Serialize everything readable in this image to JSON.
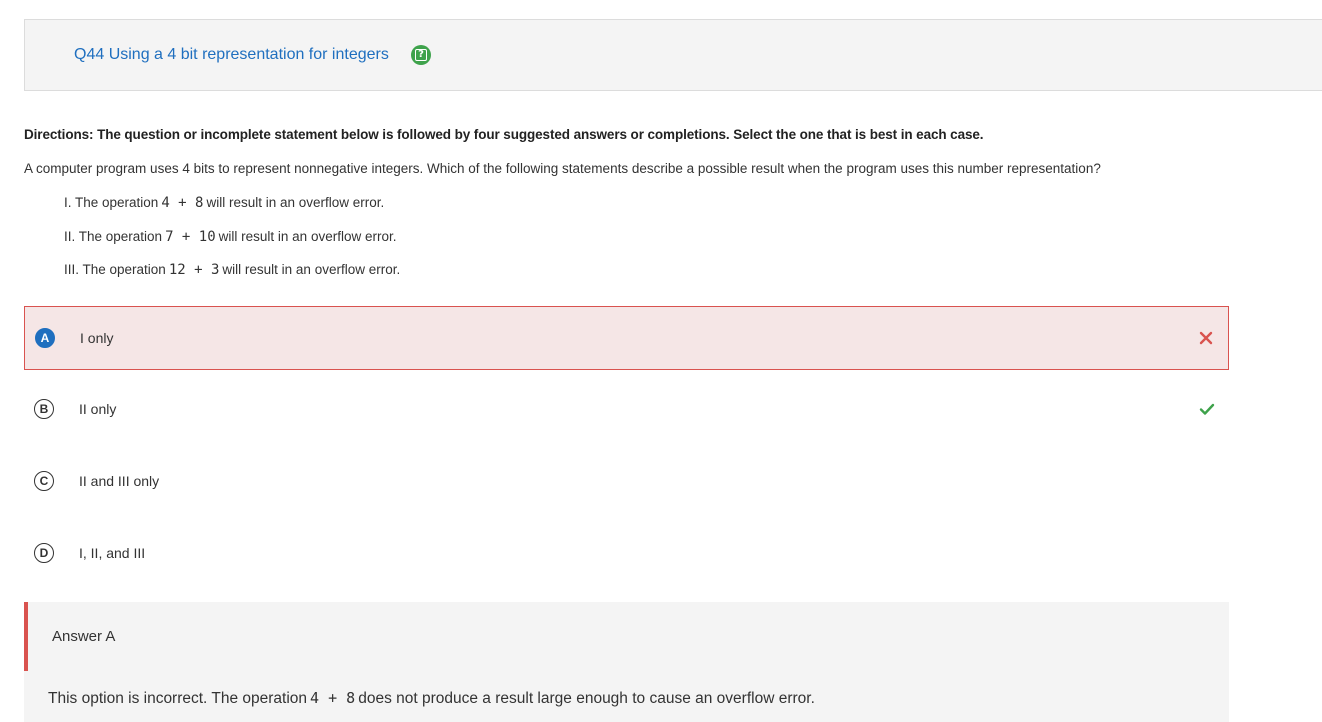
{
  "question": {
    "title": "Q44 Using a 4 bit representation for integers",
    "help_icon": "help-icon",
    "help_color": "#3ea24b",
    "directions": "Directions: The question or incomplete statement below is followed by four suggested answers or completions. Select the one that is best in each case.",
    "prompt": "A computer program uses 4 bits to represent nonnegative integers. Which of the following statements describe a possible result when the program uses this number representation?",
    "statements": [
      {
        "prefix": "I. The operation",
        "code": "4 + 8",
        "suffix": "will result in an overflow error."
      },
      {
        "prefix": "II. The operation",
        "code": "7 + 10",
        "suffix": "will result in an overflow error."
      },
      {
        "prefix": "III. The operation",
        "code": "12 + 3",
        "suffix": "will result in an overflow error."
      }
    ]
  },
  "options": [
    {
      "letter": "A",
      "text": "I only",
      "state": "selected-incorrect",
      "mark": "x-icon"
    },
    {
      "letter": "B",
      "text": "II only",
      "state": "correct",
      "mark": "check-icon"
    },
    {
      "letter": "C",
      "text": "II and III only",
      "state": "none",
      "mark": ""
    },
    {
      "letter": "D",
      "text": "I, II, and III",
      "state": "none",
      "mark": ""
    }
  ],
  "feedback": {
    "title": "Answer A",
    "explanation_prefix": "This option is incorrect. The operation",
    "explanation_code": "4 + 8",
    "explanation_suffix": "does not produce a result large enough to cause an overflow error."
  },
  "colors": {
    "accent": "#1f6fbf",
    "incorrect": "#d9534f",
    "correct": "#3ea24b"
  }
}
